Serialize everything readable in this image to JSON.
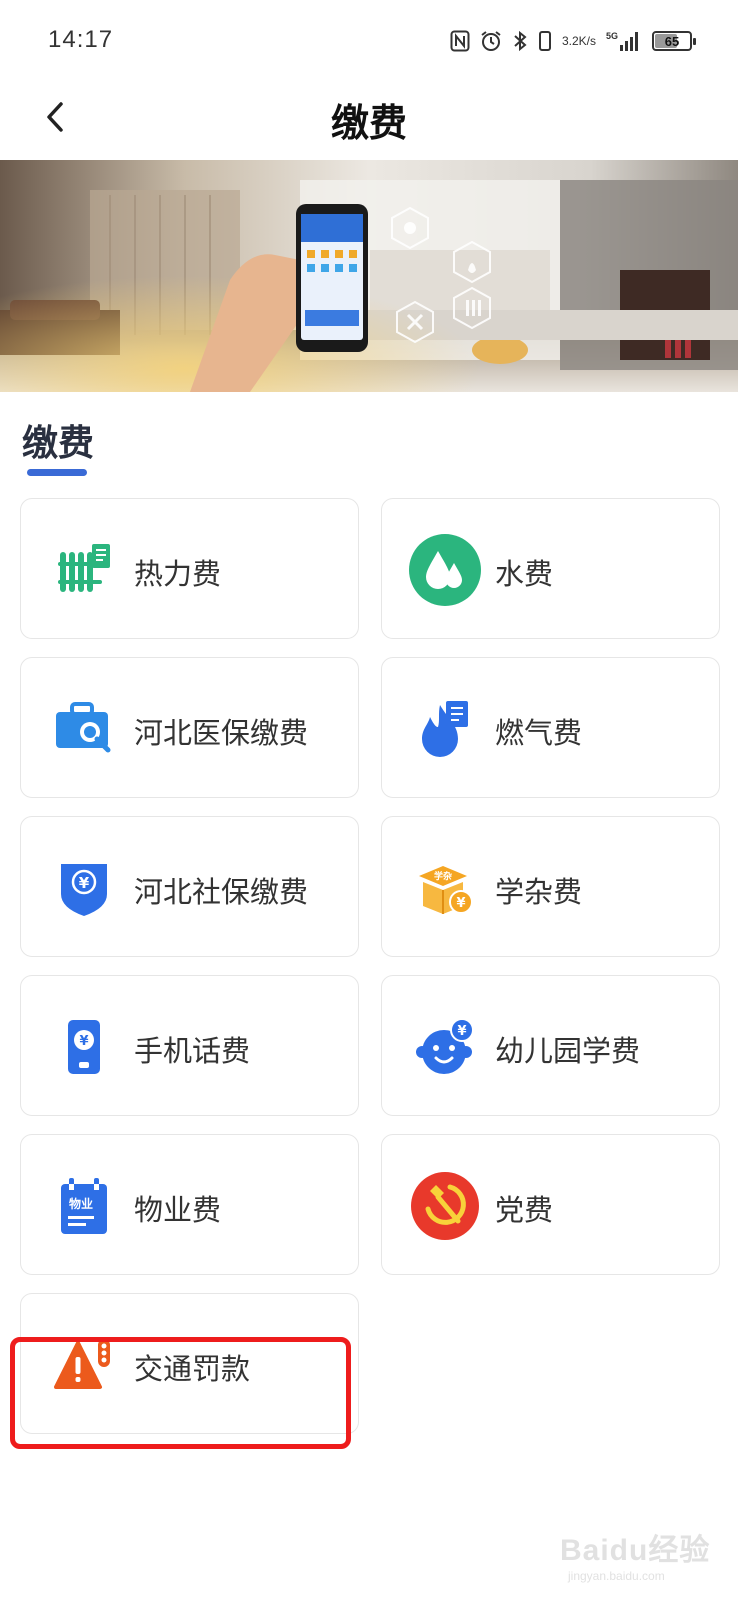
{
  "status_bar": {
    "time": "14:17",
    "speed_value": "3.2",
    "speed_unit": "K/s",
    "network": "5G",
    "battery": "65"
  },
  "header": {
    "title": "缴费",
    "back_icon": "chevron-left-icon"
  },
  "section": {
    "title": "缴费",
    "accent_color": "#3a6ad6"
  },
  "items": [
    {
      "label": "热力费",
      "icon": "heating-radiator-icon",
      "color": "#2bb57e"
    },
    {
      "label": "水费",
      "icon": "water-drop-icon",
      "color": "#2bb57e"
    },
    {
      "label": "河北医保缴费",
      "icon": "medical-insurance-icon",
      "color": "#2e8be6"
    },
    {
      "label": "燃气费",
      "icon": "gas-flame-icon",
      "color": "#2e6fe6"
    },
    {
      "label": "河北社保缴费",
      "icon": "social-security-shield-icon",
      "color": "#2e6fe6"
    },
    {
      "label": "学杂费",
      "icon": "tuition-box-icon",
      "color": "#f5a623"
    },
    {
      "label": "手机话费",
      "icon": "mobile-phone-icon",
      "color": "#2e6fe6"
    },
    {
      "label": "幼儿园学费",
      "icon": "kindergarten-face-icon",
      "color": "#2e6fe6"
    },
    {
      "label": "物业费",
      "icon": "property-notebook-icon",
      "color": "#2e6fe6"
    },
    {
      "label": "党费",
      "icon": "party-emblem-icon",
      "color": "#e8392b"
    },
    {
      "label": "交通罚款",
      "icon": "traffic-warning-icon",
      "color": "#ec5a1c"
    }
  ],
  "icon_text": {
    "tuition": "学杂",
    "property": "物业",
    "yen": "¥"
  },
  "highlight_color": "#ee1c1c",
  "watermark": {
    "logo": "Baidu经验",
    "url": "jingyan.baidu.com"
  }
}
